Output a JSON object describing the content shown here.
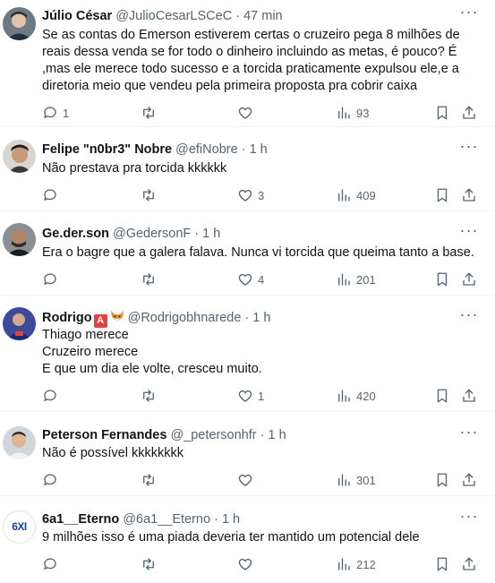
{
  "colors": {
    "text": "#0f1419",
    "muted": "#536471",
    "divider": "#eff3f4",
    "badge_red": "#e8403a"
  },
  "tweets": [
    {
      "name": "Júlio César",
      "handle": "@JulioCesarLSCeC",
      "sep": "·",
      "time": "47 min",
      "lines": [
        "Se as contas do Emerson estiverem certas o cruzeiro pega 8 milhões de",
        "reais dessa venda se for todo o dinheiro incluindo as metas, é pouco? É",
        ",mas ele merece todo sucesso e a torcida praticamente expulsou ele,e a",
        "diretoria meio que vendeu pela primeira proposta pra cobrir caixa"
      ],
      "replies": "1",
      "retweets": "",
      "likes": "",
      "views": "93"
    },
    {
      "name": "Felipe \"n0br3\" Nobre",
      "handle": "@efiNobre",
      "sep": "·",
      "time": "1 h",
      "lines": [
        "Não prestava pra torcida kkkkkk"
      ],
      "replies": "",
      "retweets": "",
      "likes": "3",
      "views": "409"
    },
    {
      "name": "Ge.der.son",
      "handle": "@GedersonF",
      "sep": "·",
      "time": "1 h",
      "lines": [
        "Era o bagre que a galera falava. Nunca vi torcida que queima tanto a base."
      ],
      "replies": "",
      "retweets": "",
      "likes": "4",
      "views": "201"
    },
    {
      "name": "Rodrigo",
      "badge": "A",
      "handle": "@Rodrigobhnarede",
      "sep": "·",
      "time": "1 h",
      "lines": [
        "Thiago merece",
        "Cruzeiro merece",
        "E que um dia ele volte, cresceu muito."
      ],
      "replies": "",
      "retweets": "",
      "likes": "1",
      "views": "420"
    },
    {
      "name": "Peterson Fernandes",
      "handle": "@_petersonhfr",
      "sep": "·",
      "time": "1 h",
      "lines": [
        "Não é possível kkkkkkkk"
      ],
      "replies": "",
      "retweets": "",
      "likes": "",
      "views": "301"
    },
    {
      "name": "6a1__Eterno",
      "handle": "@6a1__Eterno",
      "sep": "·",
      "time": "1 h",
      "avatar_text": "6XI",
      "lines": [
        "9 milhões isso é uma piada deveria ter mantido um potencial dele"
      ],
      "replies": "",
      "retweets": "",
      "likes": "",
      "views": "212"
    }
  ]
}
